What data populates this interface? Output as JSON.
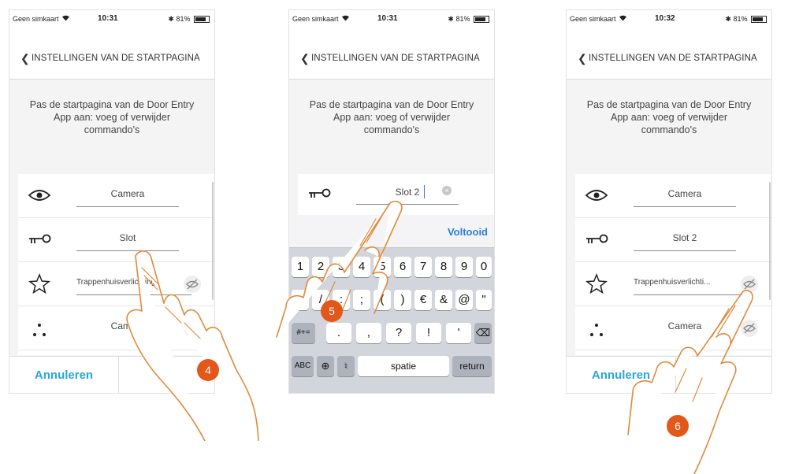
{
  "status": {
    "carrier": "Geen simkaart",
    "battery": "81%",
    "bluetooth": "bluetooth-icon",
    "wifi": "wifi-icon",
    "times": [
      "10:31",
      "10:31",
      "10:32"
    ]
  },
  "nav": {
    "back_icon": "chevron-left-icon",
    "title": "INSTELLINGEN VAN DE STARTPAGINA"
  },
  "intro": {
    "line1": "Pas de startpagina van de Door Entry",
    "line2": "App aan: voeg of verwijder",
    "line3": "commando's"
  },
  "screen1": {
    "rows": [
      {
        "icon": "eye-icon",
        "label": "Camera"
      },
      {
        "icon": "key-icon",
        "label": "Slot"
      },
      {
        "icon": "star-icon",
        "label": "Trappenhuisverlichting",
        "toggle_icon": "eye-off-icon"
      },
      {
        "icon": "dots-icon",
        "label": "Camera",
        "toggle_icon": "eye-off-icon"
      }
    ],
    "cancel": "Annuleren",
    "next": "›"
  },
  "screen2": {
    "row": {
      "icon": "key-icon",
      "value": "Slot 2",
      "clear_icon": "clear-icon"
    },
    "keyboard": {
      "done": "Voltooid",
      "row1": [
        "1",
        "2",
        "3",
        "4",
        "5",
        "6",
        "7",
        "8",
        "9",
        "0"
      ],
      "row2": [
        "-",
        "/",
        ":",
        ";",
        "(",
        ")",
        "€",
        "&",
        "@",
        "\""
      ],
      "mode_key": "#+=",
      "row3": [
        ".",
        ",",
        "?",
        "!",
        "'"
      ],
      "backspace_icon": "backspace-icon",
      "abc": "ABC",
      "globe_icon": "globe-icon",
      "mic_icon": "microphone-icon",
      "space": "spatie",
      "return": "return"
    }
  },
  "screen3": {
    "rows": [
      {
        "icon": "eye-icon",
        "label": "Camera"
      },
      {
        "icon": "key-icon",
        "label": "Slot 2"
      },
      {
        "icon": "star-icon",
        "label": "Trappenhuisverlichti...",
        "toggle_icon": "eye-off-icon"
      },
      {
        "icon": "dots-icon",
        "label": "Camera",
        "toggle_icon": "eye-off-icon"
      }
    ],
    "cancel": "Annuleren",
    "next": "›"
  },
  "steps": [
    "4",
    "5",
    "6"
  ],
  "colors": {
    "accent": "#2aa7d8",
    "badge": "#e2571a",
    "hand": "#e08a3c"
  }
}
